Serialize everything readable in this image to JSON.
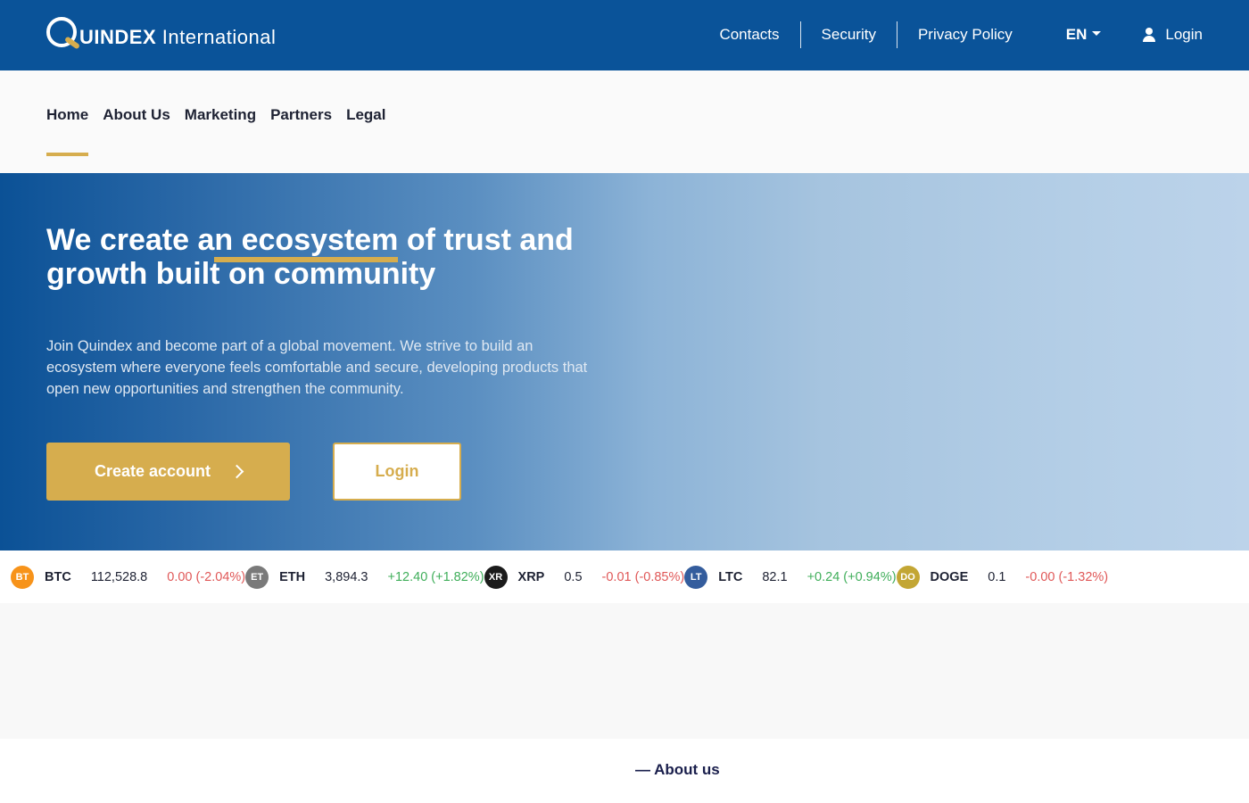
{
  "brand": {
    "initial": "Q",
    "name_bold": "UINDEX",
    "name_rest": "International"
  },
  "topnav": {
    "links": [
      "Contacts",
      "Security",
      "Privacy Policy"
    ],
    "language": "EN",
    "login": "Login"
  },
  "subnav": {
    "items": [
      "Home",
      "About Us",
      "Marketing",
      "Partners",
      "Legal"
    ],
    "active": "Home"
  },
  "hero": {
    "title_pre": "We create a",
    "title_highlight": "n ecosystem",
    "title_post": " of trust and growth built on community",
    "description": "Join Quindex and become part of a global movement. We strive to build an ecosystem where everyone feels comfortable and secure, developing products that open new opportunities and strengthen the community.",
    "primary_button": "Create account",
    "secondary_button": "Login"
  },
  "ticker": [
    {
      "badge": "BT",
      "symbol": "BTC",
      "price": "112,528.8",
      "change": "0.00 (-2.04%)",
      "direction": "neg",
      "color": "#f7931a"
    },
    {
      "badge": "ET",
      "symbol": "ETH",
      "price": "3,894.3",
      "change": "+12.40 (+1.82%)",
      "direction": "pos",
      "color": "#7a7a7a"
    },
    {
      "badge": "XR",
      "symbol": "XRP",
      "price": "0.5",
      "change": "-0.01 (-0.85%)",
      "direction": "neg",
      "color": "#1b1b1b"
    },
    {
      "badge": "LT",
      "symbol": "LTC",
      "price": "82.1",
      "change": "+0.24 (+0.94%)",
      "direction": "pos",
      "color": "#345d9d"
    },
    {
      "badge": "DO",
      "symbol": "DOGE",
      "price": "0.1",
      "change": "-0.00 (-1.32%)",
      "direction": "neg",
      "color": "#c3a634"
    }
  ],
  "about": {
    "label": "— About us"
  },
  "colors": {
    "primary": "#0a5399",
    "accent": "#d6ad4e",
    "negative": "#e05858",
    "positive": "#3fae5a"
  },
  "icons": {
    "user": "user-icon",
    "caret": "caret-down-icon",
    "chevron": "chevron-right-icon"
  }
}
